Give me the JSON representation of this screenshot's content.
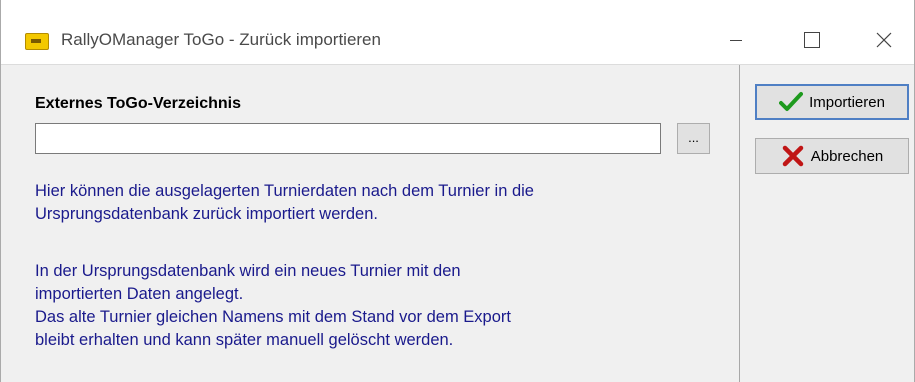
{
  "window": {
    "title": "RallyOManager ToGo - Zurück importieren",
    "controls": {
      "minimize": "—",
      "maximize": "☐",
      "close": "✕"
    }
  },
  "form": {
    "directory_label": "Externes ToGo-Verzeichnis",
    "directory_value": "",
    "browse_label": "..."
  },
  "info": {
    "paragraph1": [
      "Hier können die ausgelagerten Turnierdaten nach dem Turnier in die",
      "Ursprungsdatenbank zurück importiert werden."
    ],
    "paragraph2": [
      "In der Ursprungsdatenbank wird ein neues Turnier mit den",
      "importierten Daten angelegt.",
      "Das alte Turnier gleichen Namens mit dem Stand vor dem Export",
      "bleibt erhalten und kann später manuell gelöscht werden."
    ],
    "text_color": "#1a1a8c"
  },
  "actions": {
    "import_label": "Importieren",
    "import_icon": "checkmark-icon",
    "cancel_label": "Abbrechen",
    "cancel_icon": "red-x-icon"
  }
}
